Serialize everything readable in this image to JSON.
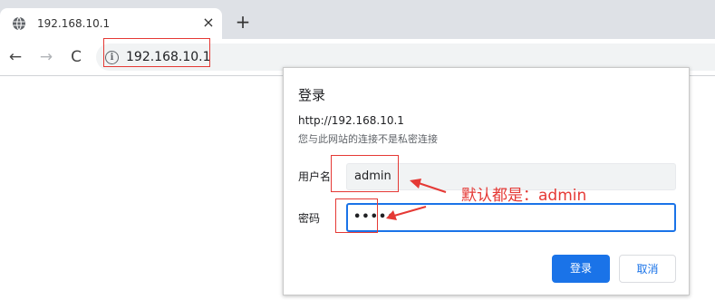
{
  "browser": {
    "tab": {
      "title": "192.168.10.1",
      "favicon": "globe-icon",
      "close_glyph": "×"
    },
    "new_tab_glyph": "+",
    "nav": {
      "back_glyph": "←",
      "forward_glyph": "→",
      "reload_glyph": "C"
    },
    "omnibox": {
      "info_glyph": "i",
      "url": "192.168.10.1"
    }
  },
  "dialog": {
    "title": "登录",
    "host": "http://192.168.10.1",
    "warning": "您与此网站的连接不是私密连接",
    "username_label": "用户名",
    "username_value": "admin",
    "password_label": "密码",
    "password_value": "•••••",
    "login_button": "登录",
    "cancel_button": "取消"
  },
  "annotation": {
    "text": "默认都是：admin",
    "color": "#e53935"
  },
  "colors": {
    "accent": "#1a73e8",
    "tabstrip": "#dee1e6",
    "omnibox": "#f1f3f4"
  }
}
